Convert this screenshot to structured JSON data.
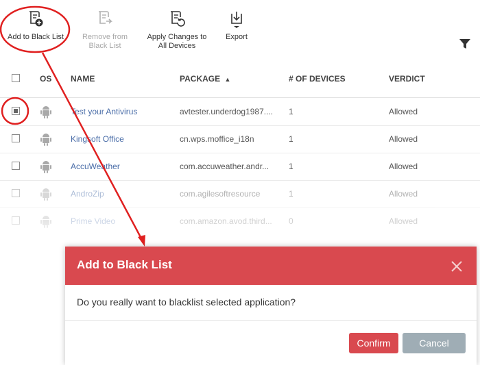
{
  "toolbar": {
    "add_label": "Add to Black List",
    "remove_label_1": "Remove from",
    "remove_label_2": "Black List",
    "apply_label_1": "Apply Changes to",
    "apply_label_2": "All Devices",
    "export_label": "Export"
  },
  "table": {
    "headers": {
      "os": "OS",
      "name": "NAME",
      "package": "PACKAGE",
      "devices": "# OF DEVICES",
      "verdict": "VERDICT"
    },
    "sort_indicator": "▲",
    "rows": [
      {
        "name": "Test your Antivirus",
        "package": "avtester.underdog1987....",
        "devices": "1",
        "verdict": "Allowed",
        "checked": true
      },
      {
        "name": "Kingsoft Office",
        "package": "cn.wps.moffice_i18n",
        "devices": "1",
        "verdict": "Allowed",
        "checked": false
      },
      {
        "name": "AccuWeather",
        "package": "com.accuweather.andr...",
        "devices": "1",
        "verdict": "Allowed",
        "checked": false
      },
      {
        "name": "AndroZip",
        "package": "com.agilesoftresource",
        "devices": "1",
        "verdict": "Allowed",
        "checked": false
      },
      {
        "name": "Prime Video",
        "package": "com.amazon.avod.third...",
        "devices": "0",
        "verdict": "Allowed",
        "checked": false
      }
    ]
  },
  "dialog": {
    "title": "Add to Black List",
    "message": "Do you really want to blacklist selected application?",
    "confirm_label": "Confirm",
    "cancel_label": "Cancel"
  },
  "colors": {
    "dialog_header": "#d9494f",
    "cancel_button": "#9fadb5",
    "link": "#4a6da8",
    "annotation": "#e02020"
  }
}
